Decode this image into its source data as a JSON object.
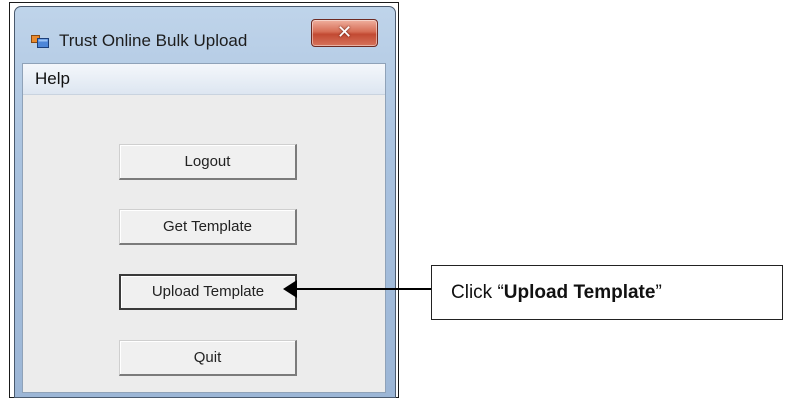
{
  "window": {
    "title": "Trust Online Bulk Upload",
    "close_glyph": "✕"
  },
  "menu": {
    "help_label": "Help"
  },
  "buttons": {
    "logout": "Logout",
    "get_template": "Get Template",
    "upload_template": "Upload Template",
    "quit": "Quit"
  },
  "callout": {
    "prefix": "Click “",
    "emphasis": "Upload Template",
    "suffix": "”"
  },
  "icons": {
    "app": "app-window-icon",
    "close": "close-icon",
    "arrow": "left-arrow-icon"
  },
  "colors": {
    "titlebar": "#a9c2df",
    "close_button": "#c24a33",
    "client_bg": "#ececec"
  }
}
